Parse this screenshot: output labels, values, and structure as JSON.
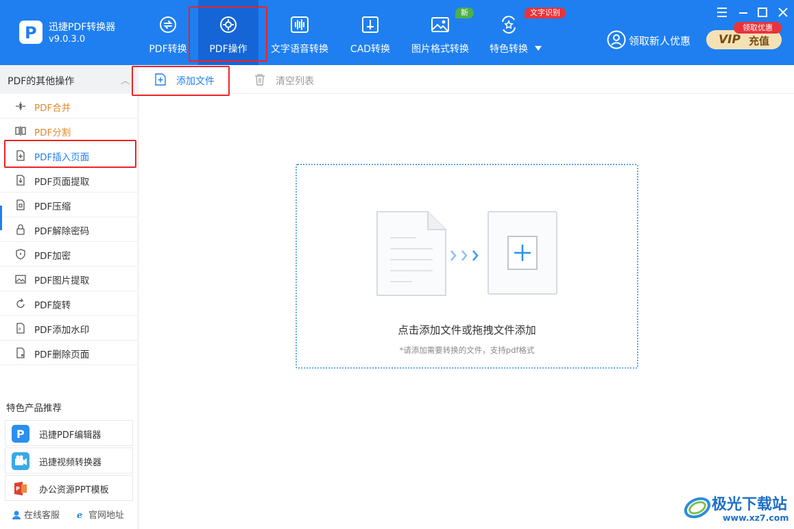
{
  "app": {
    "name": "迅捷PDF转换器",
    "version": "v9.0.3.0"
  },
  "nav": {
    "items": [
      {
        "label": "PDF转换",
        "icon": "pdf-convert-icon"
      },
      {
        "label": "PDF操作",
        "icon": "pdf-operate-icon",
        "active": true
      },
      {
        "label": "文字语音转换",
        "icon": "voice-wave-icon"
      },
      {
        "label": "CAD转换",
        "icon": "cad-icon"
      },
      {
        "label": "图片格式转换",
        "icon": "image-icon",
        "badge": "新"
      },
      {
        "label": "特色转换",
        "icon": "star-convert-icon",
        "badge": "文字识别",
        "dropdown_icon": "caret-down-icon"
      }
    ]
  },
  "promo": {
    "new_user_label": "领取新人优惠",
    "vip_label": "VIP",
    "recharge_label": "充值",
    "vip_badge": "领取优惠"
  },
  "window_controls": [
    "menu-icon",
    "minimize-icon",
    "maximize-icon",
    "close-icon"
  ],
  "sidebar": {
    "section_title": "PDF的其他操作",
    "items": [
      {
        "label": "PDF合并",
        "icon": "merge-icon"
      },
      {
        "label": "PDF分割",
        "icon": "split-icon"
      },
      {
        "label": "PDF插入页面",
        "icon": "insert-page-icon",
        "selected": true
      },
      {
        "label": "PDF页面提取",
        "icon": "page-extract-icon"
      },
      {
        "label": "PDF压缩",
        "icon": "compress-icon"
      },
      {
        "label": "PDF解除密码",
        "icon": "unlock-icon"
      },
      {
        "label": "PDF加密",
        "icon": "shield-icon"
      },
      {
        "label": "PDF图片提取",
        "icon": "image-extract-icon"
      },
      {
        "label": "PDF旋转",
        "icon": "rotate-icon"
      },
      {
        "label": "PDF添加水印",
        "icon": "watermark-icon"
      },
      {
        "label": "PDF删除页面",
        "icon": "delete-page-icon"
      }
    ],
    "featured_title": "特色产品推荐",
    "featured": [
      {
        "label": "迅捷PDF编辑器",
        "icon": "pdf-editor-icon"
      },
      {
        "label": "迅捷视频转换器",
        "icon": "video-converter-icon"
      },
      {
        "label": "办公资源PPT模板",
        "icon": "ppt-template-icon"
      }
    ],
    "footer": {
      "service_label": "在线客服",
      "website_label": "官网地址"
    }
  },
  "toolbar": {
    "add_file_label": "添加文件",
    "clear_list_label": "清空列表"
  },
  "dropzone": {
    "main_text": "点击添加文件或拖拽文件添加",
    "sub_text": "*请添加需要转换的文件，支持pdf格式"
  },
  "watermark": {
    "title": "极光下载站",
    "url": "www.xz7.com"
  },
  "colors": {
    "primary": "#1f7ff0",
    "active_nav": "#1565d6",
    "highlight_red": "#ec2324",
    "orange_text": "#e28a2b"
  }
}
